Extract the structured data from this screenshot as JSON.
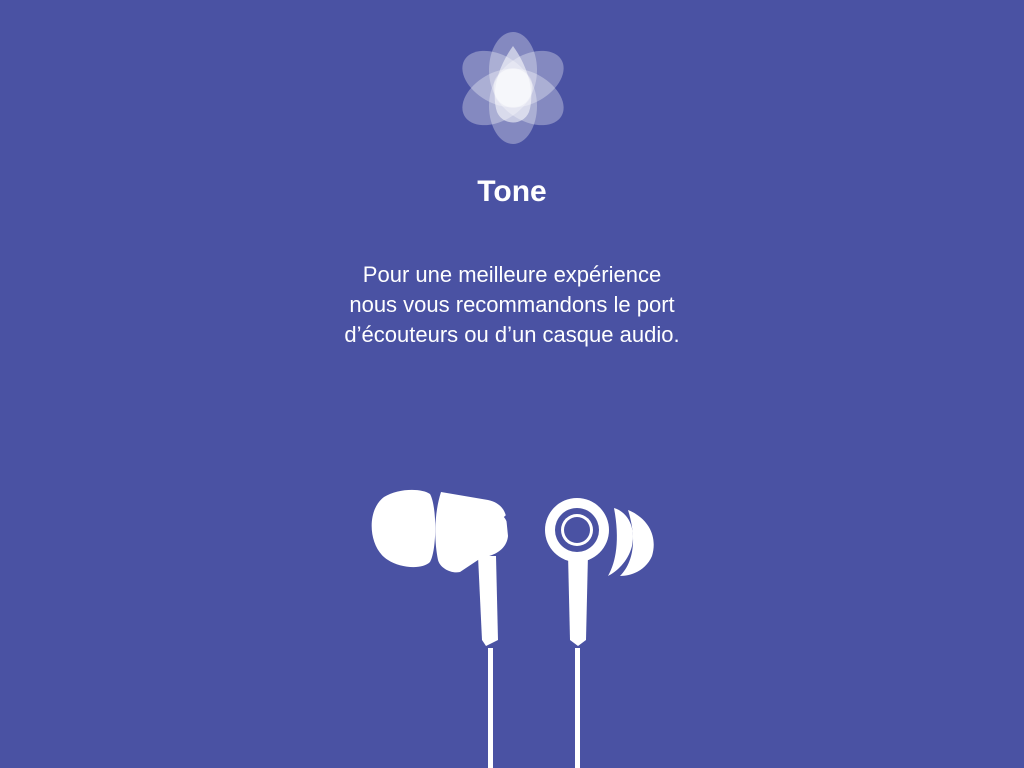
{
  "app": {
    "title": "Tone"
  },
  "message": {
    "lines": [
      "Pour une meilleure expérience",
      "nous vous recommandons le port",
      "d’écouteurs ou d’un casque audio."
    ]
  },
  "icons": {
    "logo": "flower-logo-icon",
    "illustration": "earbuds-icon"
  },
  "colors": {
    "background": "#4a52a3",
    "foreground": "#ffffff"
  }
}
